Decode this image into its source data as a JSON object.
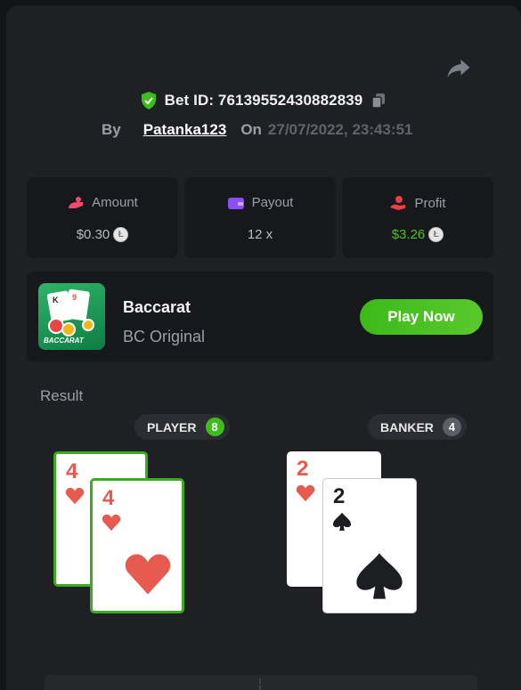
{
  "header": {
    "bet_id_label": "Bet ID: 7613955243088283​9",
    "by_label": "By",
    "username": "Patanka123",
    "on_label": "On",
    "datetime": "27/07/2022, 23:43:51"
  },
  "stats": {
    "amount_label": "Amount",
    "amount_value": "$0.30",
    "payout_label": "Payout",
    "payout_value": "12 x",
    "profit_label": "Profit",
    "profit_value": "$3.26"
  },
  "game": {
    "title": "Baccarat",
    "subtitle": "BC Original",
    "thumb_text": "BACCARAT",
    "play_label": "Play Now"
  },
  "result": {
    "label": "Result",
    "player_label": "PLAYER",
    "player_score": "8",
    "banker_label": "BANKER",
    "banker_score": "4",
    "player_cards": [
      {
        "rank": "4",
        "suit": "hearts"
      },
      {
        "rank": "4",
        "suit": "hearts"
      }
    ],
    "banker_cards": [
      {
        "rank": "2",
        "suit": "hearts"
      },
      {
        "rank": "2",
        "suit": "spades"
      }
    ]
  },
  "colors": {
    "accent_green": "#3fbd1b",
    "background": "#1f2024",
    "panel": "#17181b"
  },
  "icons": [
    "share-icon",
    "shield-check-icon",
    "copy-icon",
    "amount-icon",
    "wallet-icon",
    "profit-icon",
    "coin-icon",
    "heart-suit-icon",
    "spade-suit-icon"
  ]
}
